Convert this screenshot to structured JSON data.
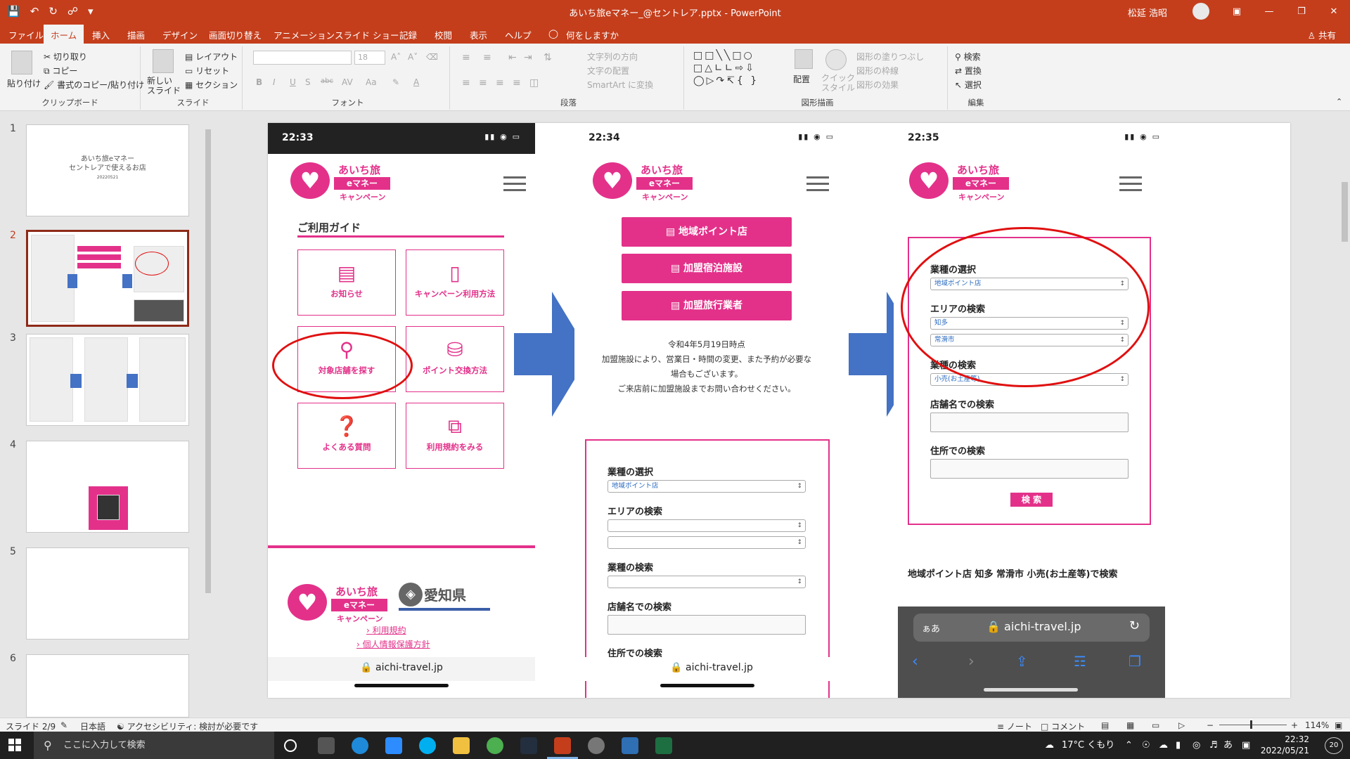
{
  "app": {
    "doc_title": "あいち旅eマネー_@セントレア.pptx  -  PowerPoint",
    "user_name": "松延 浩昭"
  },
  "tabs": [
    "ファイル",
    "ホーム",
    "挿入",
    "描画",
    "デザイン",
    "画面切り替え",
    "アニメーション",
    "スライド ショー",
    "記録",
    "校閲",
    "表示",
    "ヘルプ"
  ],
  "tell_me": "何をしますか",
  "share": "共有",
  "ribbon": {
    "clipboard": {
      "paste": "貼り付け",
      "cut": "切り取り",
      "copy": "コピー",
      "format_painter": "書式のコピー/貼り付け",
      "label": "クリップボード"
    },
    "slides": {
      "new_slide": "新しい\nスライド",
      "layout": "レイアウト",
      "reset": "リセット",
      "section": "セクション",
      "label": "スライド"
    },
    "font": {
      "size": "18",
      "label": "フォント",
      "bold": "B",
      "italic": "I",
      "underline": "U",
      "shadow": "S",
      "strike": "abc",
      "spacing": "AV",
      "case": "Aa",
      "color": "A"
    },
    "paragraph": {
      "text_direction": "文字列の方向",
      "align_text": "文字の配置",
      "smartart": "SmartArt に変換",
      "label": "段落"
    },
    "drawing": {
      "arrange": "配置",
      "quick_styles": "クイック\nスタイル",
      "shape_fill": "図形の塗りつぶし",
      "shape_outline": "図形の枠線",
      "shape_effects": "図形の効果",
      "label": "図形描画"
    },
    "editing": {
      "find": "検索",
      "replace": "置換",
      "select": "選択",
      "label": "編集"
    }
  },
  "thumbnails": [
    {
      "num": "1",
      "line1": "あいち旅eマネー",
      "line2": "セントレアで使えるお店",
      "line3": "20220521"
    },
    {
      "num": "2"
    },
    {
      "num": "3"
    },
    {
      "num": "4"
    },
    {
      "num": "5"
    },
    {
      "num": "6"
    }
  ],
  "phone1": {
    "time": "22:33",
    "logo": {
      "line1": "あいち旅",
      "line2": "eマネー",
      "line3": "キャンペーン"
    },
    "guide_title": "ご利用ガイド",
    "cards": [
      {
        "label": "お知らせ",
        "icon": "news-icon"
      },
      {
        "label": "キャンペーン利用方法",
        "icon": "phone-icon"
      },
      {
        "label": "対象店舗を探す",
        "icon": "search-icon"
      },
      {
        "label": "ポイント交換方法",
        "icon": "coins-icon"
      },
      {
        "label": "よくある質問",
        "icon": "question-icon"
      },
      {
        "label": "利用規約をみる",
        "icon": "documents-icon"
      }
    ],
    "aichi_pref": "愛知県",
    "links": [
      "利用規約",
      "個人情報保護方針"
    ],
    "url": "aichi-travel.jp"
  },
  "phone2": {
    "time": "22:34",
    "buttons": [
      "地域ポイント店",
      "加盟宿泊施設",
      "加盟旅行業者"
    ],
    "notice": [
      "令和4年5月19日時点",
      "加盟施設により、営業日・時間の変更、また予約が必要な",
      "場合もございます。",
      "ご来店前に加盟施設までお問い合わせください。"
    ],
    "form": {
      "type_label": "業種の選択",
      "type_value": "地域ポイント店",
      "area_label": "エリアの検索",
      "biz_label": "業種の検索",
      "shop_label": "店舗名での検索",
      "address_label": "住所での検索"
    },
    "url": "aichi-travel.jp"
  },
  "phone3": {
    "time": "22:35",
    "form": {
      "type_label": "業種の選択",
      "type_value": "地域ポイント店",
      "area_label": "エリアの検索",
      "area_value1": "知多",
      "area_value2": "常滑市",
      "biz_label": "業種の検索",
      "biz_value": "小売(お土産等)",
      "shop_label": "店舗名での検索",
      "address_label": "住所での検索",
      "search_button": "検 索"
    },
    "result": "地域ポイント店 知多 常滑市 小売(お土産等)で検索",
    "safari": {
      "aa": "ぁあ",
      "url": "aichi-travel.jp"
    }
  },
  "statusbar": {
    "slide": "スライド 2/9",
    "language": "日本語",
    "accessibility": "アクセシビリティ: 検討が必要です",
    "notes": "ノート",
    "comments": "コメント",
    "zoom": "114%"
  },
  "taskbar": {
    "search": "ここに入力して検索",
    "weather": "17°C くもり",
    "ime": "あ",
    "time": "22:32",
    "date": "2022/05/21",
    "notifications": "20"
  },
  "colors": {
    "office_red": "#c43e1c",
    "brand_pink": "#e3318a",
    "arrow_blue": "#4472c4",
    "circle_red": "#e01010"
  }
}
